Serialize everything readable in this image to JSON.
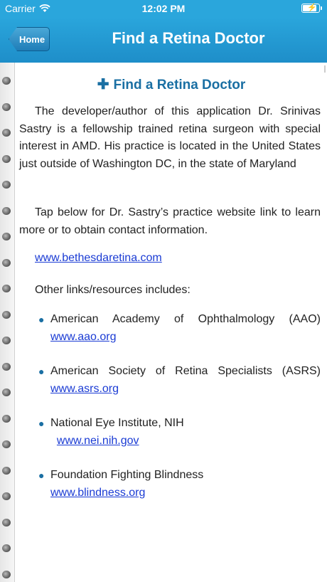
{
  "status": {
    "carrier": "Carrier",
    "time": "12:02 PM"
  },
  "nav": {
    "home": "Home",
    "title": "Find a Retina Doctor"
  },
  "content": {
    "heading": "Find a Retina Doctor",
    "para1": "The developer/author of this application Dr. Srinivas Sastry is a fellowship trained retina surgeon with special interest in AMD. His practice is located in the United States just outside of Washington DC, in the state of Maryland",
    "para2": "Tap below for Dr. Sastry’s practice website link to learn more or to obtain contact information.",
    "main_link": "www.bethesdaretina.com",
    "other": "Other links/resources includes:",
    "resources": [
      {
        "name": "American Academy of Ophthalmology (AAO)",
        "link": "www.aao.org"
      },
      {
        "name": "American Society of Retina Specialists (ASRS)",
        "link": "www.asrs.org"
      },
      {
        "name": "National Eye Institute, NIH",
        "link": "www.nei.nih.gov"
      },
      {
        "name": "Foundation Fighting Blindness",
        "link": "www.blindness.org"
      }
    ]
  }
}
